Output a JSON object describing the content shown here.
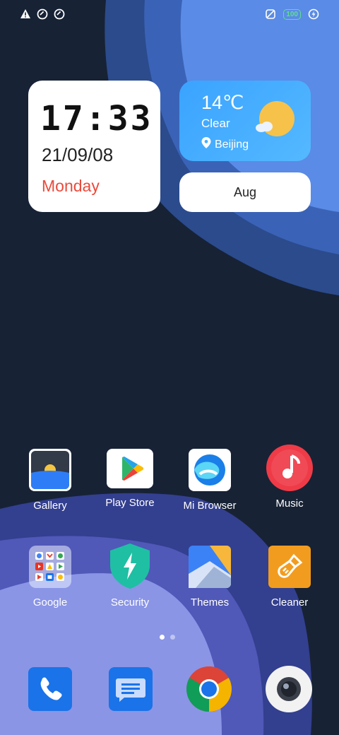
{
  "clock": {
    "time": "17:33",
    "date": "21/09/08",
    "day": "Monday"
  },
  "weather": {
    "temperature": "14℃",
    "condition": "Clear",
    "location": "Beijing"
  },
  "calendar": {
    "month": "Aug"
  },
  "status": {
    "battery": "100"
  },
  "apps_row1": [
    {
      "label": "Gallery",
      "icon": "gallery-icon"
    },
    {
      "label": "Play Store",
      "icon": "play-store-icon"
    },
    {
      "label": "Mi Browser",
      "icon": "mi-browser-icon"
    },
    {
      "label": "Music",
      "icon": "music-icon"
    }
  ],
  "apps_row2": [
    {
      "label": "Google",
      "icon": "google-folder-icon"
    },
    {
      "label": "Security",
      "icon": "security-icon"
    },
    {
      "label": "Themes",
      "icon": "themes-icon"
    },
    {
      "label": "Cleaner",
      "icon": "cleaner-icon"
    }
  ],
  "dock": [
    {
      "icon": "phone-icon"
    },
    {
      "icon": "messages-icon"
    },
    {
      "icon": "chrome-icon"
    },
    {
      "icon": "camera-icon"
    }
  ],
  "page_indicator": {
    "pages": 2,
    "current": 1
  }
}
